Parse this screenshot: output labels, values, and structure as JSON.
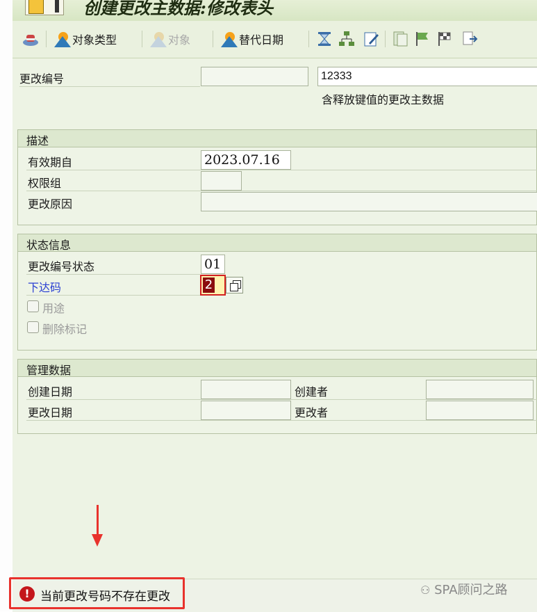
{
  "window": {
    "title": "创建更改主数据:修改表头"
  },
  "toolbar": {
    "items": [
      {
        "label": "对象类型",
        "enabled": true
      },
      {
        "label": "对象",
        "enabled": false
      },
      {
        "label": "替代日期",
        "enabled": true
      }
    ]
  },
  "header": {
    "change_no_label": "更改编号",
    "change_no_value": "12333",
    "change_no_desc": "含释放键值的更改主数据"
  },
  "desc_group": {
    "title": "描述",
    "valid_from_label": "有效期自",
    "valid_from_value": "2023.07.16",
    "auth_group_label": "权限组",
    "reason_label": "更改原因"
  },
  "status_group": {
    "title": "状态信息",
    "status_label": "更改编号状态",
    "status_value": "01",
    "release_label": "下达码",
    "release_value": "2",
    "usage_label": "用途",
    "delete_label": "删除标记"
  },
  "admin_group": {
    "title": "管理数据",
    "created_on_label": "创建日期",
    "created_by_label": "创建者",
    "changed_on_label": "更改日期",
    "changed_by_label": "更改者"
  },
  "status_bar": {
    "message": "当前更改号码不存在更改",
    "watermark": "SPA顾问之路"
  },
  "colors": {
    "error": "#c4161c",
    "highlight": "#e8322c",
    "link": "#2a3fd2"
  }
}
